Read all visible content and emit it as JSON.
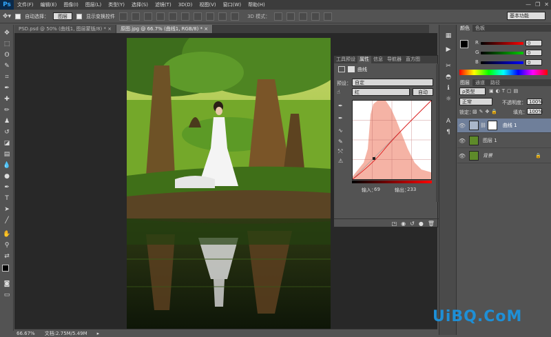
{
  "app": {
    "logo": "Ps"
  },
  "menu": [
    "文件(F)",
    "编辑(E)",
    "图像(I)",
    "图层(L)",
    "类型(Y)",
    "选择(S)",
    "滤镜(T)",
    "3D(D)",
    "视图(V)",
    "窗口(W)",
    "帮助(H)"
  ],
  "options": {
    "auto_select_label": "自动选择：",
    "auto_select_value": "图层",
    "show_transform_label": "显示变换控件",
    "mode_3d": "3D 模式：",
    "workspace": "基本功能"
  },
  "tabs": [
    {
      "label": "PSD.psd @ 50% (曲线1, 图层蒙版/8) *"
    },
    {
      "label": "原图.jpg @ 66.7% (曲线1, RGB/8) *"
    }
  ],
  "status": {
    "zoom": "66.67%",
    "doc": "文档:2.75M/5.49M"
  },
  "properties": {
    "tabs": [
      "工具预设",
      "属性",
      "信息",
      "导航器",
      "直方图"
    ],
    "title": "曲线",
    "preset_label": "预设：",
    "preset_value": "自定",
    "channel_value": "红",
    "auto_label": "自动",
    "input_label": "输入：",
    "input_value": "69",
    "output_label": "输出：",
    "output_value": "233"
  },
  "color_panel": {
    "tabs": [
      "颜色",
      "色板"
    ],
    "r_label": "R",
    "g_label": "G",
    "b_label": "B",
    "r_value": "0",
    "g_value": "0",
    "b_value": "0"
  },
  "layers_panel": {
    "tabs": [
      "图层",
      "通道",
      "路径"
    ],
    "kind": "ρ类型",
    "blend": "正常",
    "opacity_label": "不透明度：",
    "opacity_value": "100%",
    "lock_label": "锁定：",
    "fill_label": "填充：",
    "fill_value": "100%",
    "layers": [
      {
        "name": "曲线 1"
      },
      {
        "name": "图层 1"
      },
      {
        "name": "背景"
      }
    ]
  },
  "watermark": "UiBQ.CoM"
}
